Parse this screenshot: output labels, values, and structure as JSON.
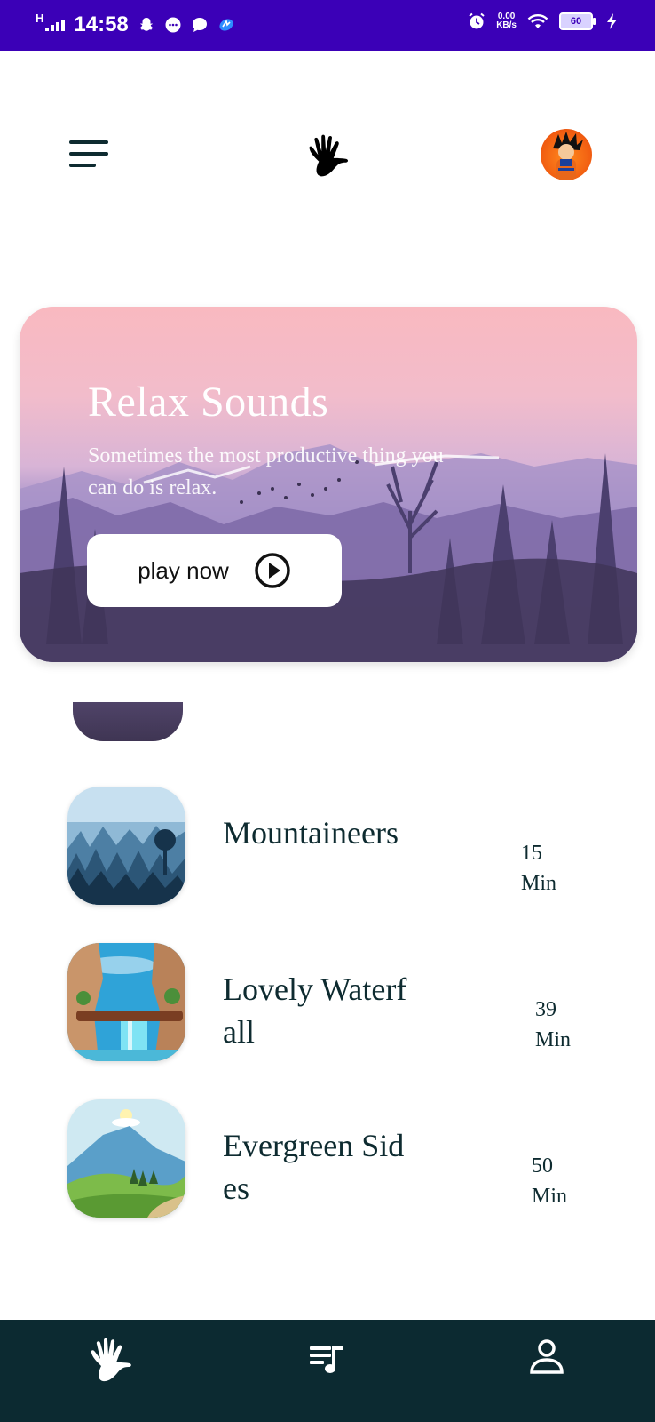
{
  "status_bar": {
    "network": "H",
    "time": "14:58",
    "speed_value": "0.00",
    "speed_unit": "KB/s",
    "battery": "60"
  },
  "hero": {
    "title": "Relax Sounds",
    "subtitle": "Sometimes the most productive thing you can do is relax.",
    "button_label": "play now"
  },
  "tracks": [
    {
      "title": "Mountaineers",
      "duration": "15",
      "unit": "Min"
    },
    {
      "title": "Lovely Waterfall",
      "duration": "39",
      "unit": "Min"
    },
    {
      "title": "Evergreen Sides",
      "duration": "50",
      "unit": "Min"
    }
  ],
  "icons": {
    "menu": "hamburger-icon",
    "logo": "hand-icon",
    "profile": "avatar",
    "nav_home": "hand-icon",
    "nav_playlist": "playlist-icon",
    "nav_profile": "person-icon"
  },
  "colors": {
    "status_bar": "#3b00b7",
    "bottom_nav": "#0c2a31",
    "text": "#0e2b30"
  }
}
